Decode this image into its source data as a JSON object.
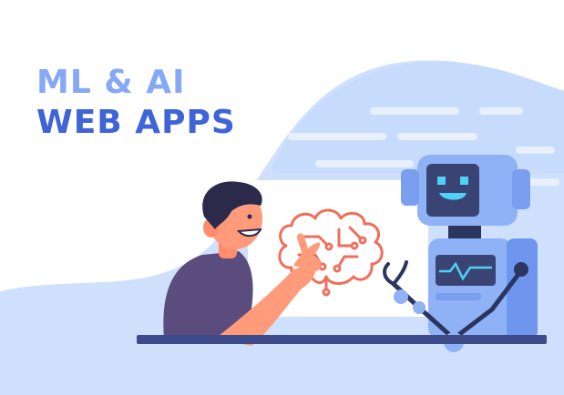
{
  "headline": {
    "line1": "ML & AI",
    "line2": "WEB APPS"
  },
  "colors": {
    "blob": "#cfe0fd",
    "headline_light": "#85a9f5",
    "headline_dark": "#3f64d8",
    "robot_body": "#8fb2f6",
    "robot_dark": "#2b3560",
    "robot_face": "#3a4474",
    "robot_eye": "#4fd1f5",
    "brain": "#f26d5b",
    "skin": "#ff9a7a",
    "shirt": "#5a4d7e",
    "hair": "#2c2a4a",
    "board": "#ffffff",
    "table": "#3d4b8a"
  },
  "icons": [
    "brain-circuit-icon",
    "robot-illustration",
    "person-illustration"
  ]
}
